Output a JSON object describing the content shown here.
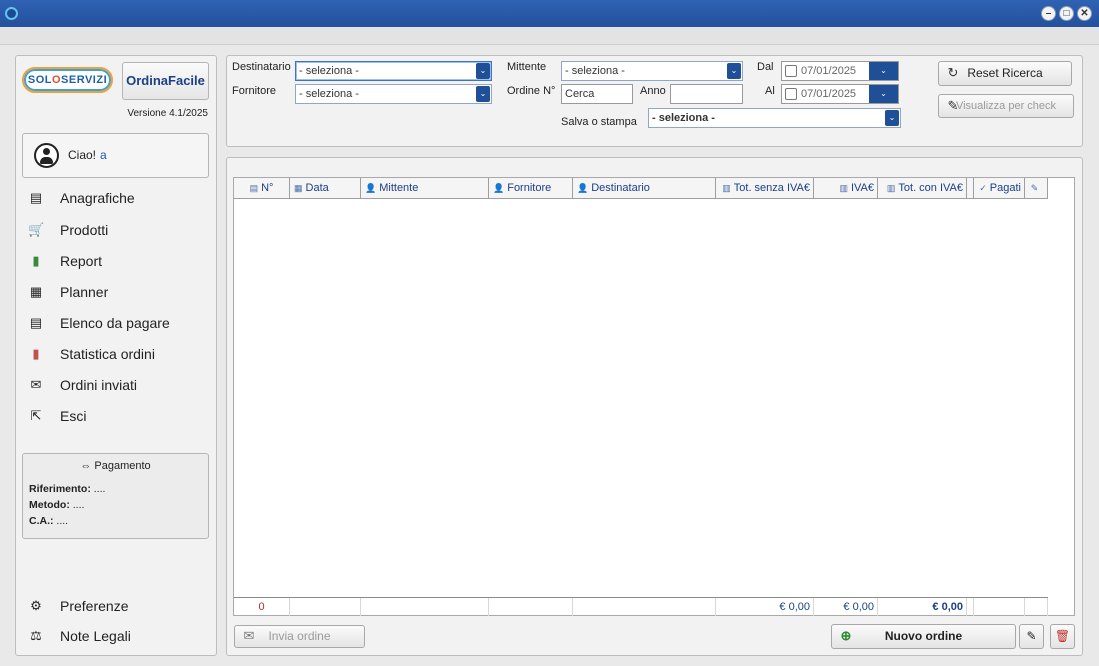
{
  "window": {
    "minimize_glyph": "–",
    "maximize_glyph": "□",
    "close_glyph": "✕"
  },
  "sidebar": {
    "logo_text_a": "SOL",
    "logo_text_o": "O",
    "logo_text_b": "SERVIZI",
    "app_name": "OrdinaFacile",
    "version": "Versione 4.1/2025",
    "greeting": "Ciao!",
    "user_name": "a",
    "items": [
      {
        "label": "Anagrafiche",
        "icon": "id-card-icon",
        "glyph": "▤"
      },
      {
        "label": "Prodotti",
        "icon": "cart-icon",
        "glyph": "🛒"
      },
      {
        "label": "Report",
        "icon": "bar-chart-icon",
        "glyph": "▮"
      },
      {
        "label": "Planner",
        "icon": "calendar-icon",
        "glyph": "▦"
      },
      {
        "label": "Elenco da pagare",
        "icon": "list-icon",
        "glyph": "▤"
      },
      {
        "label": "Statistica ordini",
        "icon": "stats-icon",
        "glyph": "▮"
      },
      {
        "label": "Ordini inviati",
        "icon": "envelope-icon",
        "glyph": "✉"
      },
      {
        "label": "Esci",
        "icon": "exit-icon",
        "glyph": "⇱"
      }
    ],
    "payment": {
      "title": "Pagamento",
      "title_glyph": "⇔",
      "rows": [
        {
          "label": "Riferimento:",
          "value": "...."
        },
        {
          "label": "Metodo:",
          "value": "...."
        },
        {
          "label": "C.A.:",
          "value": "...."
        }
      ]
    },
    "bottom_items": [
      {
        "label": "Preferenze",
        "icon": "gear-icon",
        "glyph": "⚙"
      },
      {
        "label": "Note Legali",
        "icon": "scales-icon",
        "glyph": "⚖"
      }
    ]
  },
  "filters": {
    "destinatario_label": "Destinatario",
    "destinatario_value": "- seleziona -",
    "fornitore_label": "Fornitore",
    "fornitore_value": "- seleziona -",
    "mittente_label": "Mittente",
    "mittente_value": "- seleziona -",
    "ordine_label": "Ordine N°",
    "ordine_placeholder": "Cerca",
    "anno_label": "Anno",
    "anno_value": "",
    "dal_label": "Dal",
    "dal_value": "07/01/2025",
    "al_label": "Al",
    "al_value": "07/01/2025",
    "salva_label": "Salva o stampa",
    "salva_value": "- seleziona -",
    "reset_button": "Reset Ricerca",
    "check_button": "Visualizza per check",
    "dropdown_glyph": "⌄"
  },
  "table": {
    "columns": [
      {
        "label": "N°",
        "icon": "document-icon",
        "glyph": "▤"
      },
      {
        "label": "Data",
        "icon": "calendar-icon",
        "glyph": "▦"
      },
      {
        "label": "Mittente",
        "icon": "person-icon",
        "glyph": "👤"
      },
      {
        "label": "Fornitore",
        "icon": "person-icon",
        "glyph": "👤"
      },
      {
        "label": "Destinatario",
        "icon": "person-icon",
        "glyph": "👤"
      },
      {
        "label": "Tot. senza IVA€",
        "icon": "building-icon",
        "glyph": "▥"
      },
      {
        "label": "IVA€",
        "icon": "building-icon",
        "glyph": "▥"
      },
      {
        "label": "Tot. con IVA€",
        "icon": "building-icon",
        "glyph": "▥"
      },
      {
        "label": "",
        "icon": "",
        "glyph": ""
      },
      {
        "label": "Pagati",
        "icon": "check-icon",
        "glyph": "✓"
      },
      {
        "label": "",
        "icon": "pin-icon",
        "glyph": "✎"
      }
    ],
    "rows": [],
    "footer": {
      "count": "0",
      "tot_senza_iva": "€ 0,00",
      "iva": "€ 0,00",
      "tot_con_iva": "€ 0,00"
    }
  },
  "actions": {
    "invia_button": "Invia ordine",
    "nuovo_button": "Nuovo ordine"
  }
}
